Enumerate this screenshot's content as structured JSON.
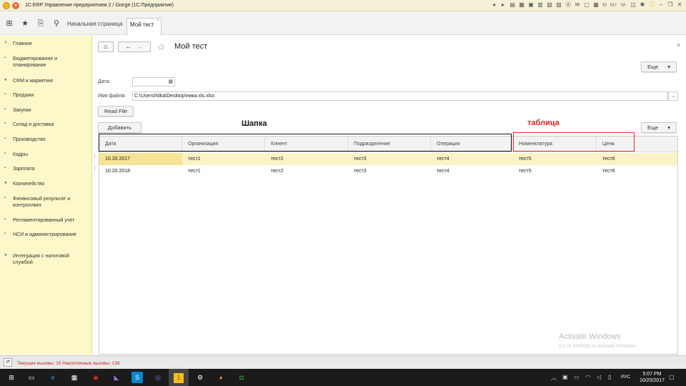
{
  "window": {
    "title": "1С:ERP Управление предприятием 2 / Giorge  (1С:Предприятие)",
    "title_icons": [
      "back-icon",
      "forward-icon",
      "page-icon",
      "calendar-icon",
      "image-icon",
      "calc-icon",
      "grid-icon",
      "text-icon",
      "font-icon",
      "mail-icon",
      "doc-icon",
      "calendar2-icon"
    ],
    "memory_buttons": [
      "M",
      "M+",
      "M-"
    ],
    "controls": [
      "minimize",
      "restore",
      "close"
    ]
  },
  "section_bar": {
    "icons": [
      "apps-grid-icon",
      "star-icon",
      "history-icon",
      "search-icon"
    ],
    "tabs": [
      {
        "label": "Начальная страница",
        "active": false
      },
      {
        "label": "Мой тест",
        "active": true,
        "close": "×"
      }
    ]
  },
  "sidebar": {
    "items": [
      {
        "label": "Главное",
        "bullet": "≡"
      },
      {
        "label": "Бюджетирование и планирование",
        "bullet": "▪"
      },
      {
        "label": "CRM и маркетинг",
        "bullet": "●"
      },
      {
        "label": "Продажи",
        "bullet": "▪"
      },
      {
        "label": "Закупки",
        "bullet": "▪"
      },
      {
        "label": "Склад и доставка",
        "bullet": "▪"
      },
      {
        "label": "Производство",
        "bullet": "▪"
      },
      {
        "label": "Кадры",
        "bullet": "▪"
      },
      {
        "label": "Зарплата",
        "bullet": "▪"
      },
      {
        "label": "Казначейство",
        "bullet": "●"
      },
      {
        "label": "Финансовый результат и контроллинг",
        "bullet": "▪"
      },
      {
        "label": "Регламентированный учет",
        "bullet": "▪"
      },
      {
        "label": "НСИ и администрирование",
        "bullet": "▪"
      },
      {
        "label": "Интеграция с налоговой службой",
        "bullet": "●"
      }
    ]
  },
  "form": {
    "title": "Мой тест",
    "more_label": "Еще",
    "date_label": "Дата:",
    "date_placeholder": ". .",
    "file_label": "Имя файла:",
    "file_value": "C:\\Users\\Nika\\Desktop\\ника.xls.xlsx",
    "file_browse": "...",
    "read_file_label": "Read File",
    "add_label": "Добавить",
    "table_more_label": "Еще"
  },
  "table": {
    "columns": [
      "Дата",
      "Организация",
      "Клиент",
      "Подразделение",
      "Операция",
      "Номенклатура",
      "Цена"
    ],
    "rows": [
      [
        "10.20.2017",
        "тест1",
        "тест2",
        "тест3",
        "тест4",
        "тест5",
        "тест6"
      ],
      [
        "10.20.2018",
        "тест1",
        "тест2",
        "тест3",
        "тест4",
        "тест5",
        "тест6"
      ]
    ]
  },
  "annotations": {
    "header_label": "Шапка",
    "table_label": "таблица",
    "colors": {
      "black": "#111111",
      "red": "#e02020"
    }
  },
  "watermark": {
    "line1": "Activate Windows",
    "line2": "Go to Settings to activate Windows."
  },
  "status": {
    "text": "Текущие вызовы: 15   Накопленные вызовы: 138"
  },
  "taskbar": {
    "apps": [
      "windows-start-icon",
      "task-view-icon",
      "edge-icon",
      "store-icon",
      "app-red-icon",
      "visual-studio-icon",
      "skype-icon",
      "viber-icon",
      "1c-icon",
      "settings-icon",
      "chrome-icon",
      "evernote-icon"
    ],
    "language": "РУС",
    "time": "5:07 PM",
    "date": "10/20/2017"
  }
}
